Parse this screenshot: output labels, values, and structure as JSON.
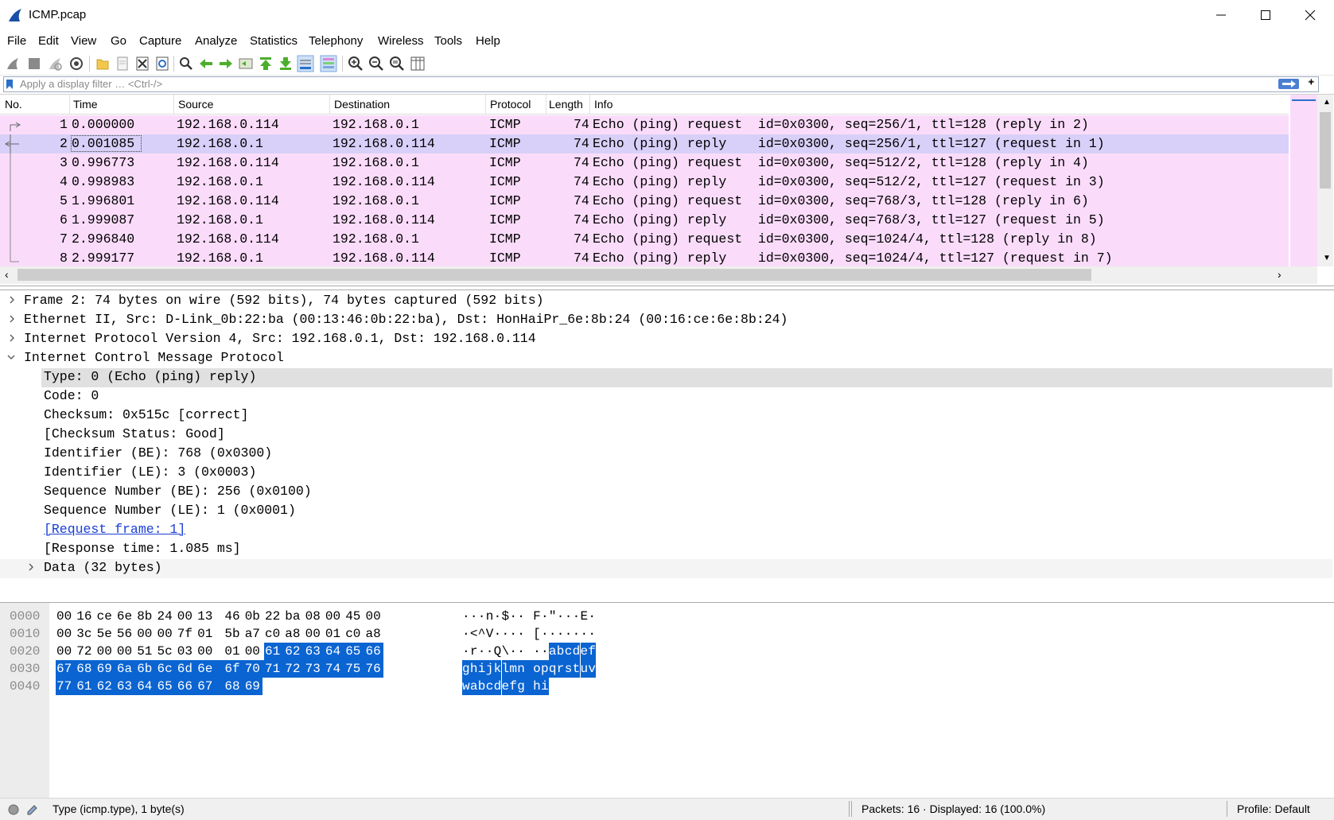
{
  "window": {
    "title": "ICMP.pcap"
  },
  "menu": [
    "File",
    "Edit",
    "View",
    "Go",
    "Capture",
    "Analyze",
    "Statistics",
    "Telephony",
    "Wireless",
    "Tools",
    "Help"
  ],
  "filter": {
    "placeholder": "Apply a display filter … <Ctrl-/>",
    "plus": "+"
  },
  "columns": [
    "No.",
    "Time",
    "Source",
    "Destination",
    "Protocol",
    "Length",
    "Info"
  ],
  "packets": [
    {
      "no": "1",
      "time": "0.000000",
      "src": "192.168.0.114",
      "dst": "192.168.0.1",
      "proto": "ICMP",
      "len": "74",
      "info": "Echo (ping) request  id=0x0300, seq=256/1, ttl=128 (reply in 2)"
    },
    {
      "no": "2",
      "time": "0.001085",
      "src": "192.168.0.1",
      "dst": "192.168.0.114",
      "proto": "ICMP",
      "len": "74",
      "info": "Echo (ping) reply    id=0x0300, seq=256/1, ttl=127 (request in 1)"
    },
    {
      "no": "3",
      "time": "0.996773",
      "src": "192.168.0.114",
      "dst": "192.168.0.1",
      "proto": "ICMP",
      "len": "74",
      "info": "Echo (ping) request  id=0x0300, seq=512/2, ttl=128 (reply in 4)"
    },
    {
      "no": "4",
      "time": "0.998983",
      "src": "192.168.0.1",
      "dst": "192.168.0.114",
      "proto": "ICMP",
      "len": "74",
      "info": "Echo (ping) reply    id=0x0300, seq=512/2, ttl=127 (request in 3)"
    },
    {
      "no": "5",
      "time": "1.996801",
      "src": "192.168.0.114",
      "dst": "192.168.0.1",
      "proto": "ICMP",
      "len": "74",
      "info": "Echo (ping) request  id=0x0300, seq=768/3, ttl=128 (reply in 6)"
    },
    {
      "no": "6",
      "time": "1.999087",
      "src": "192.168.0.1",
      "dst": "192.168.0.114",
      "proto": "ICMP",
      "len": "74",
      "info": "Echo (ping) reply    id=0x0300, seq=768/3, ttl=127 (request in 5)"
    },
    {
      "no": "7",
      "time": "2.996840",
      "src": "192.168.0.114",
      "dst": "192.168.0.1",
      "proto": "ICMP",
      "len": "74",
      "info": "Echo (ping) request  id=0x0300, seq=1024/4, ttl=128 (reply in 8)"
    },
    {
      "no": "8",
      "time": "2.999177",
      "src": "192.168.0.1",
      "dst": "192.168.0.114",
      "proto": "ICMP",
      "len": "74",
      "info": "Echo (ping) reply    id=0x0300, seq=1024/4, ttl=127 (request in 7)"
    }
  ],
  "details": [
    "Frame 2: 74 bytes on wire (592 bits), 74 bytes captured (592 bits)",
    "Ethernet II, Src: D-Link_0b:22:ba (00:13:46:0b:22:ba), Dst: HonHaiPr_6e:8b:24 (00:16:ce:6e:8b:24)",
    "Internet Protocol Version 4, Src: 192.168.0.1, Dst: 192.168.0.114",
    "Internet Control Message Protocol",
    "Type: 0 (Echo (ping) reply)",
    "Code: 0",
    "Checksum: 0x515c [correct]",
    "[Checksum Status: Good]",
    "Identifier (BE): 768 (0x0300)",
    "Identifier (LE): 3 (0x0003)",
    "Sequence Number (BE): 256 (0x0100)",
    "Sequence Number (LE): 1 (0x0001)",
    "[Request frame: 1]",
    "[Response time: 1.085 ms]",
    "Data (32 bytes)"
  ],
  "hex": {
    "offsets": [
      "0000",
      "0010",
      "0020",
      "0030",
      "0040"
    ],
    "bytes": [
      [
        "00",
        "16",
        "ce",
        "6e",
        "8b",
        "24",
        "00",
        "13",
        "46",
        "0b",
        "22",
        "ba",
        "08",
        "00",
        "45",
        "00"
      ],
      [
        "00",
        "3c",
        "5e",
        "56",
        "00",
        "00",
        "7f",
        "01",
        "5b",
        "a7",
        "c0",
        "a8",
        "00",
        "01",
        "c0",
        "a8"
      ],
      [
        "00",
        "72",
        "00",
        "00",
        "51",
        "5c",
        "03",
        "00",
        "01",
        "00",
        "61",
        "62",
        "63",
        "64",
        "65",
        "66"
      ],
      [
        "67",
        "68",
        "69",
        "6a",
        "6b",
        "6c",
        "6d",
        "6e",
        "6f",
        "70",
        "71",
        "72",
        "73",
        "74",
        "75",
        "76"
      ],
      [
        "77",
        "61",
        "62",
        "63",
        "64",
        "65",
        "66",
        "67",
        "68",
        "69"
      ]
    ],
    "ascii": [
      [
        "·",
        "·",
        "·",
        "n",
        "·",
        "$",
        "·",
        "·",
        "F",
        "·",
        "\"",
        "·",
        "·",
        "·",
        "E",
        "·"
      ],
      [
        "·",
        "<",
        "^",
        "V",
        "·",
        "·",
        "·",
        "·",
        "[",
        "·",
        "·",
        "·",
        "·",
        "·",
        "·",
        "·"
      ],
      [
        "·",
        "r",
        "·",
        "·",
        "Q",
        "\\",
        "·",
        "·",
        "·",
        "·",
        "a",
        "b",
        "c",
        "d",
        "e",
        "f"
      ],
      [
        "g",
        "h",
        "i",
        "j",
        "k",
        "l",
        "m",
        "n",
        "o",
        "p",
        "q",
        "r",
        "s",
        "t",
        "u",
        "v"
      ],
      [
        "w",
        "a",
        "b",
        "c",
        "d",
        "e",
        "f",
        "g",
        "h",
        "i"
      ]
    ]
  },
  "status": {
    "field": "Type (icmp.type), 1 byte(s)",
    "packets": "Packets: 16 · Displayed: 16 (100.0%)",
    "profile": "Profile: Default"
  }
}
